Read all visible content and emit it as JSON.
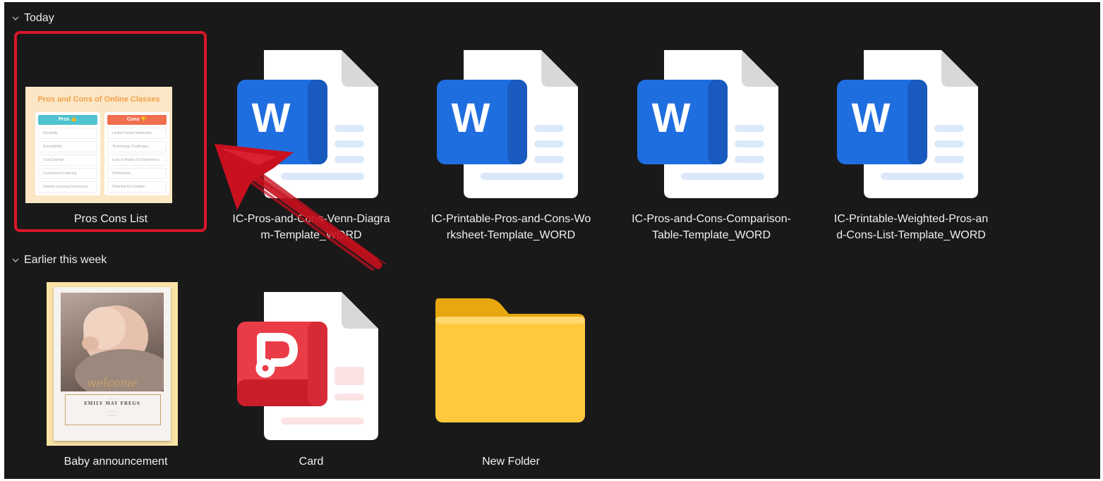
{
  "groups": {
    "today": "Today",
    "earlier": "Earlier this week"
  },
  "files": {
    "pros_cons_list": "Pros Cons List",
    "venn_line1": "IC-Pros-and-Cons-Venn-Diagra",
    "venn_line2": "m-Template_WORD",
    "worksheet_line1": "IC-Printable-Pros-and-Cons-Wo",
    "worksheet_line2": "rksheet-Template_WORD",
    "comparison_line1": "IC-Pros-and-Cons-Comparison-",
    "comparison_line2": "Table-Template_WORD",
    "weighted_line1": "IC-Printable-Weighted-Pros-an",
    "weighted_line2": "d-Cons-List-Template_WORD",
    "baby": "Baby announcement",
    "card": "Card",
    "folder": "New Folder"
  },
  "thumbnail": {
    "title": "Pros and Cons of Online Classes",
    "pros_header": "Pros 👍",
    "cons_header": "Cons 👎",
    "pros": [
      "Flexibility",
      "Accessibility",
      "Cost Savings",
      "Customized Learning",
      "Diverse Learning Resources"
    ],
    "cons": [
      "Limited Social Interaction",
      "Technology Challenges",
      "Lack of Hands-On Experience",
      "Distractions",
      "Potential for Isolation"
    ]
  },
  "baby_card": {
    "welcome": "welcome",
    "name": "EMILY MAY FREGS"
  },
  "icons": {
    "word": "W",
    "wps": "P"
  },
  "colors": {
    "background": "#191919",
    "selection": "#d8162a",
    "word_blue": "#185abd",
    "folder_yellow": "#ffc83d",
    "wps_red": "#e8313b"
  }
}
